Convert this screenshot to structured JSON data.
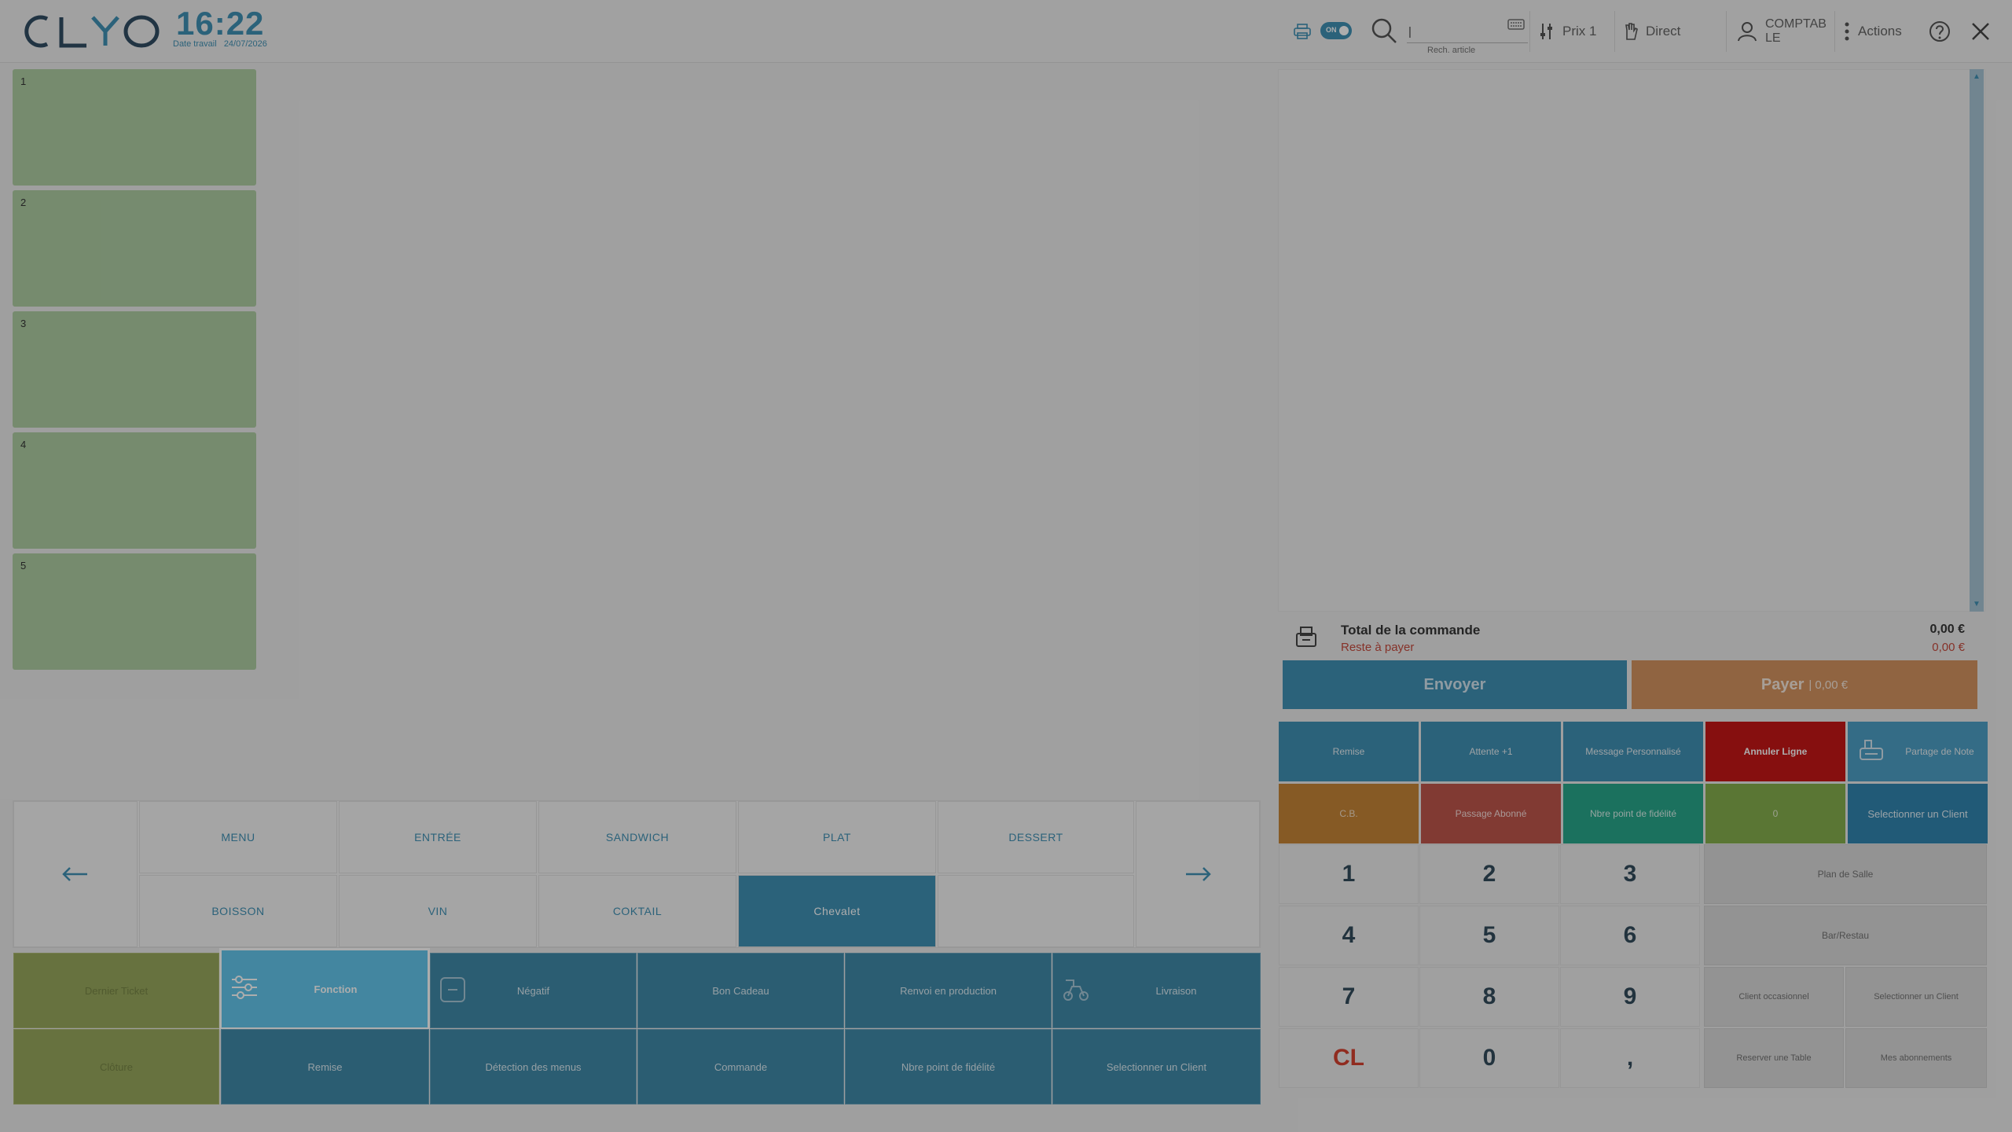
{
  "header": {
    "logo": "CLYO",
    "time": "16:22",
    "date_label": "Date travail",
    "date_value": "24/07/2026",
    "printer_toggle": "ON",
    "search_value": "|",
    "search_hint": "Rech. article",
    "price_label": "Prix 1",
    "mode_label": "Direct",
    "user_label": "COMPTAB\nLE",
    "actions_label": "Actions"
  },
  "slots": [
    "1",
    "2",
    "3",
    "4",
    "5"
  ],
  "categories": {
    "row1": [
      "MENU",
      "ENTRÉE",
      "SANDWICH",
      "PLAT",
      "DESSERT"
    ],
    "row2": [
      "BOISSON",
      "VIN",
      "COKTAIL",
      "Chevalet",
      ""
    ]
  },
  "functions": {
    "row1": [
      "Dernier Ticket",
      "Fonction",
      "Négatif",
      "Bon Cadeau",
      "Renvoi en production",
      "Livraison"
    ],
    "row2": [
      "Clôture",
      "Remise",
      "Détection des menus",
      "Commande",
      "Nbre point de fidélité",
      "Selectionner un Client"
    ]
  },
  "order": {
    "total_label": "Total de la commande",
    "total_value": "0,00 €",
    "reste_label": "Reste à payer",
    "reste_value": "0,00 €",
    "send_label": "Envoyer",
    "pay_label": "Payer",
    "pay_amount": "| 0,00 €"
  },
  "actions_row1": [
    "Remise",
    "Attente +1",
    "Message Personnalisé",
    "Annuler Ligne",
    "Partage de Note"
  ],
  "actions_row2": [
    "C.B.",
    "Passage Abonné",
    "Nbre point de fidélité",
    "0",
    "Selectionner un Client"
  ],
  "keypad": [
    "1",
    "2",
    "3",
    "4",
    "5",
    "6",
    "7",
    "8",
    "9",
    "CL",
    "0",
    ","
  ],
  "side_buttons": {
    "plan": "Plan de Salle",
    "bar": "Bar/Restau",
    "client_occ": "Client occasionnel",
    "select_client": "Selectionner un Client",
    "reserve": "Reserver une Table",
    "abos": "Mes abonnements"
  },
  "colors": {
    "accent": "#2e86ad",
    "slot_green": "#a6c89a",
    "olive": "#8fa04e",
    "highlight": "#55c1ea",
    "danger": "#c00000",
    "orange": "#d08a52"
  }
}
